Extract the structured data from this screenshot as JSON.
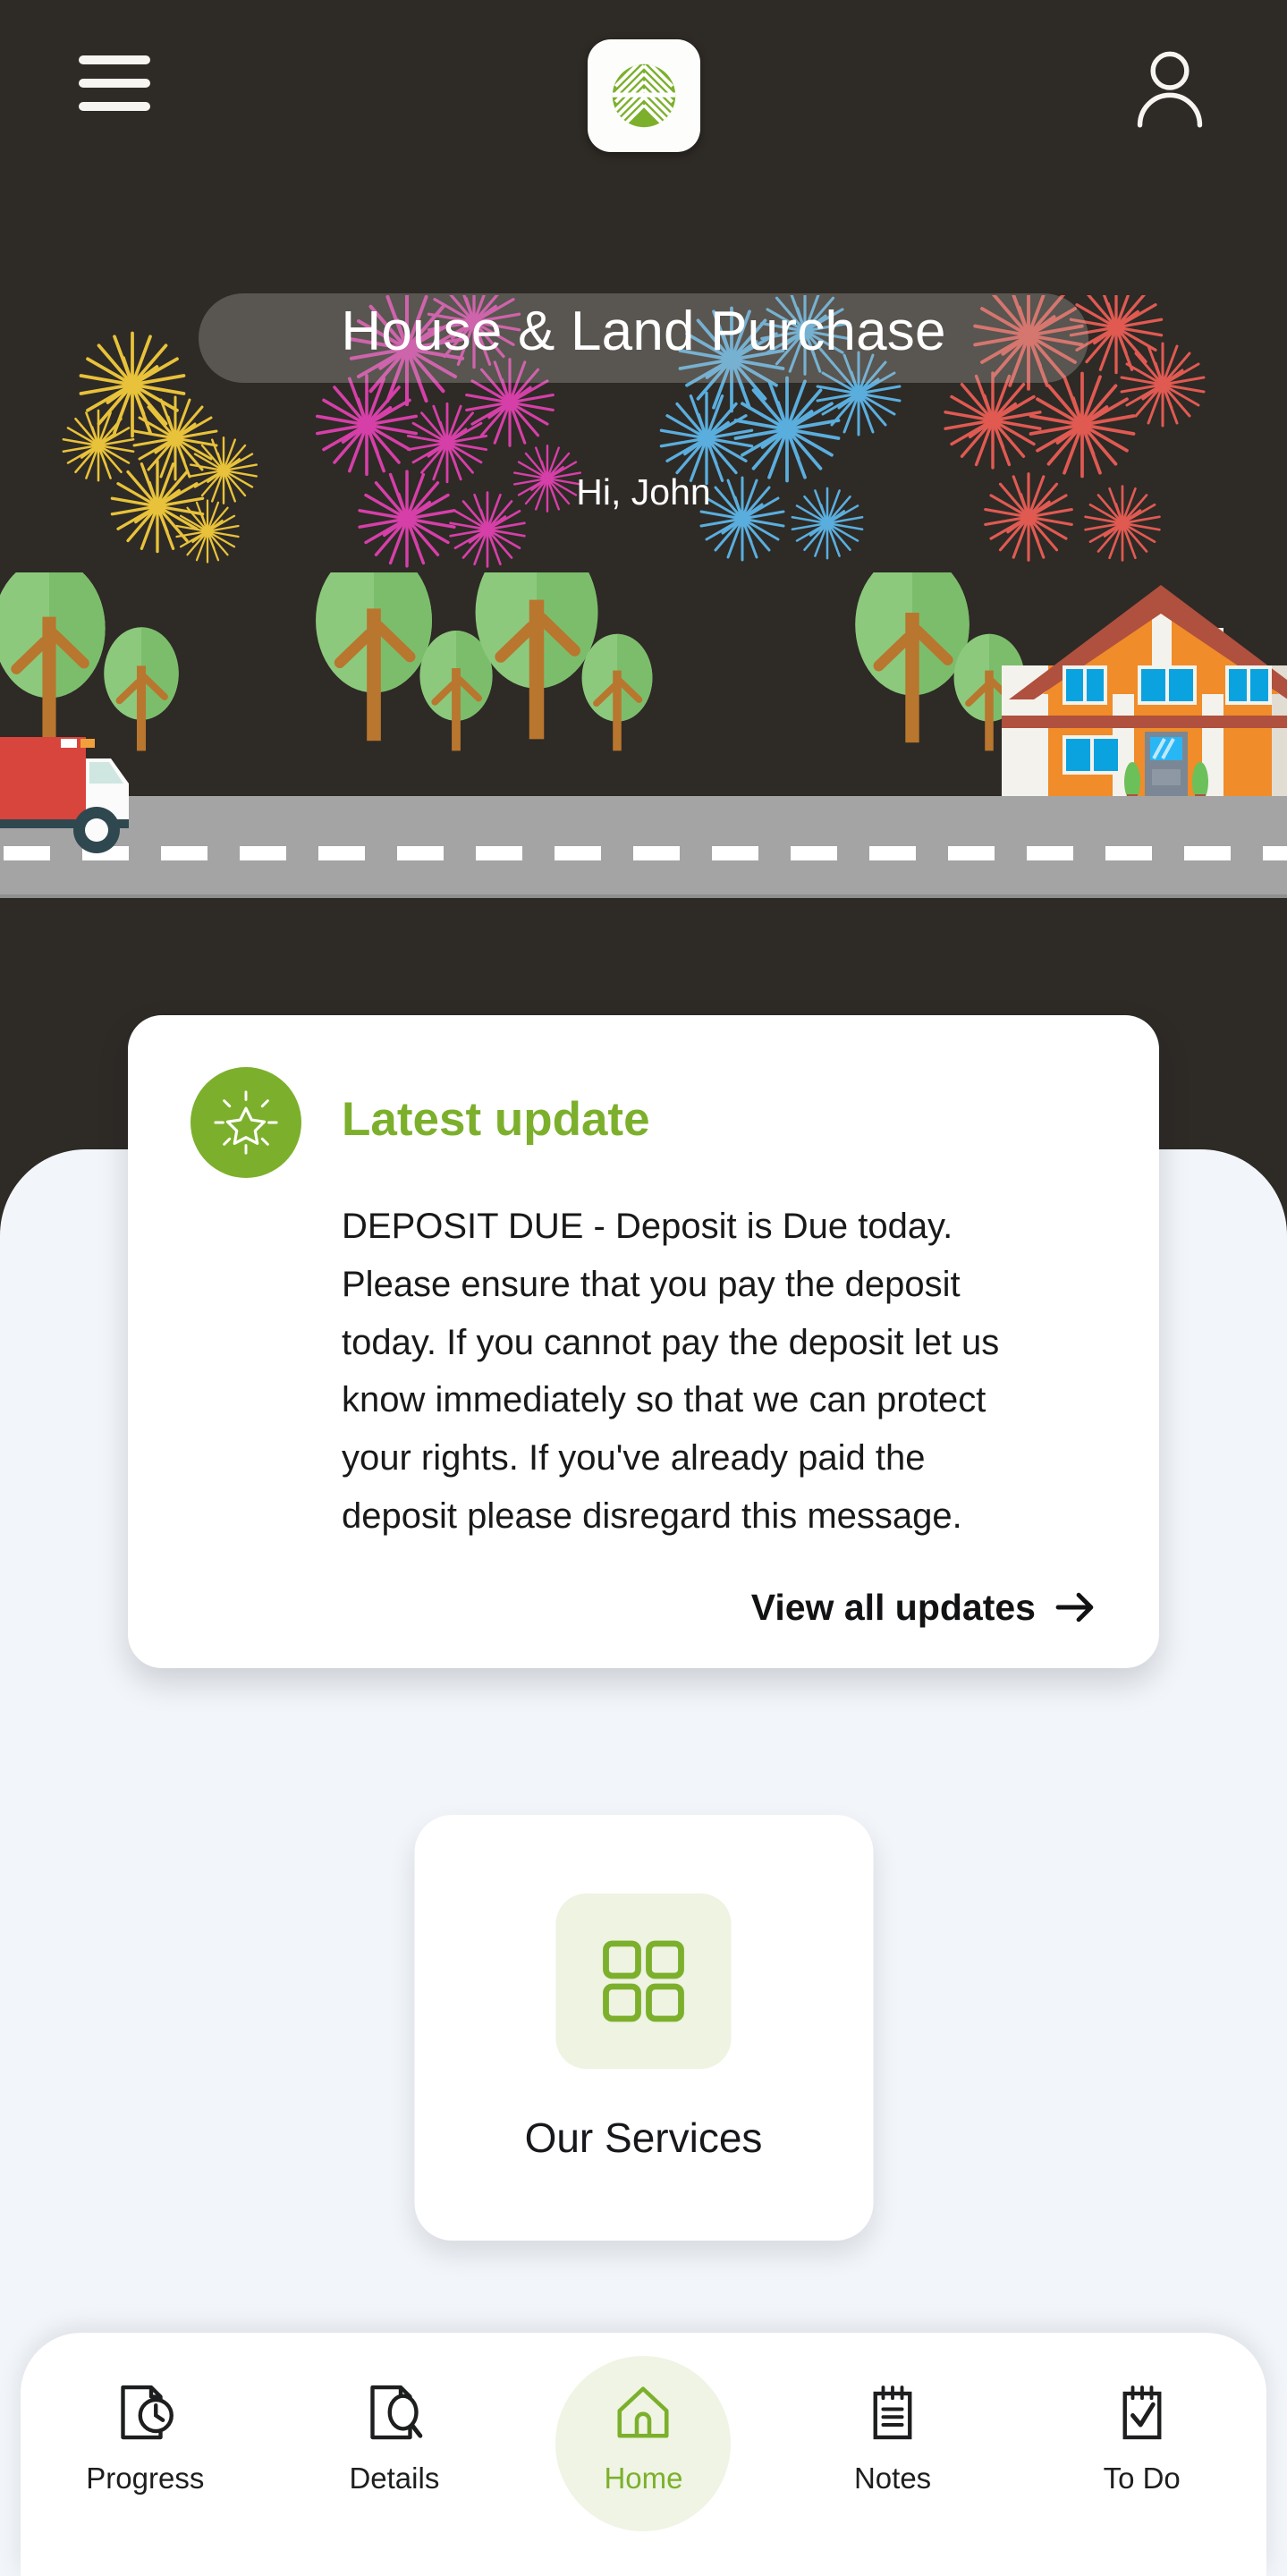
{
  "header": {
    "menu_icon": "hamburger-menu-icon",
    "logo_icon": "brand-leaf-logo-icon",
    "account_icon": "user-account-icon"
  },
  "hero": {
    "title": "House & Land Purchase",
    "greeting": "Hi, John",
    "illustration": {
      "elements": [
        "moving-truck",
        "trees",
        "road",
        "house"
      ],
      "fireworks_colors": [
        "#e8c23a",
        "#d63fa8",
        "#5aaede",
        "#e05a52"
      ]
    }
  },
  "latest_update": {
    "badge_icon": "sparkle-star-icon",
    "title": "Latest update",
    "body": "DEPOSIT DUE - Deposit is Due today. Please ensure that you pay the deposit today. If you cannot pay the deposit let us know immediately so that we can protect your rights. If you've already paid the deposit please disregard this message.",
    "link_label": "View all updates",
    "link_icon": "arrow-right-icon"
  },
  "services": {
    "icon": "grid-four-squares-icon",
    "label": "Our Services"
  },
  "bottom_nav": {
    "items": [
      {
        "id": "progress",
        "label": "Progress",
        "icon": "document-clock-icon",
        "active": false
      },
      {
        "id": "details",
        "label": "Details",
        "icon": "document-search-icon",
        "active": false
      },
      {
        "id": "home",
        "label": "Home",
        "icon": "house-outline-icon",
        "active": true
      },
      {
        "id": "notes",
        "label": "Notes",
        "icon": "notepad-lines-icon",
        "active": false
      },
      {
        "id": "todo",
        "label": "To Do",
        "icon": "notepad-check-icon",
        "active": false
      }
    ]
  },
  "colors": {
    "brand_green": "#7cb02c",
    "hero_dark": "#2e2a26",
    "sheet_bg": "#f2f5f9",
    "card_white": "#ffffff",
    "house_orange": "#f08c29",
    "roof_red": "#b0503e",
    "truck_red": "#d8453c",
    "tree_green": "#83c474",
    "road_gray": "#a4a4a4"
  }
}
